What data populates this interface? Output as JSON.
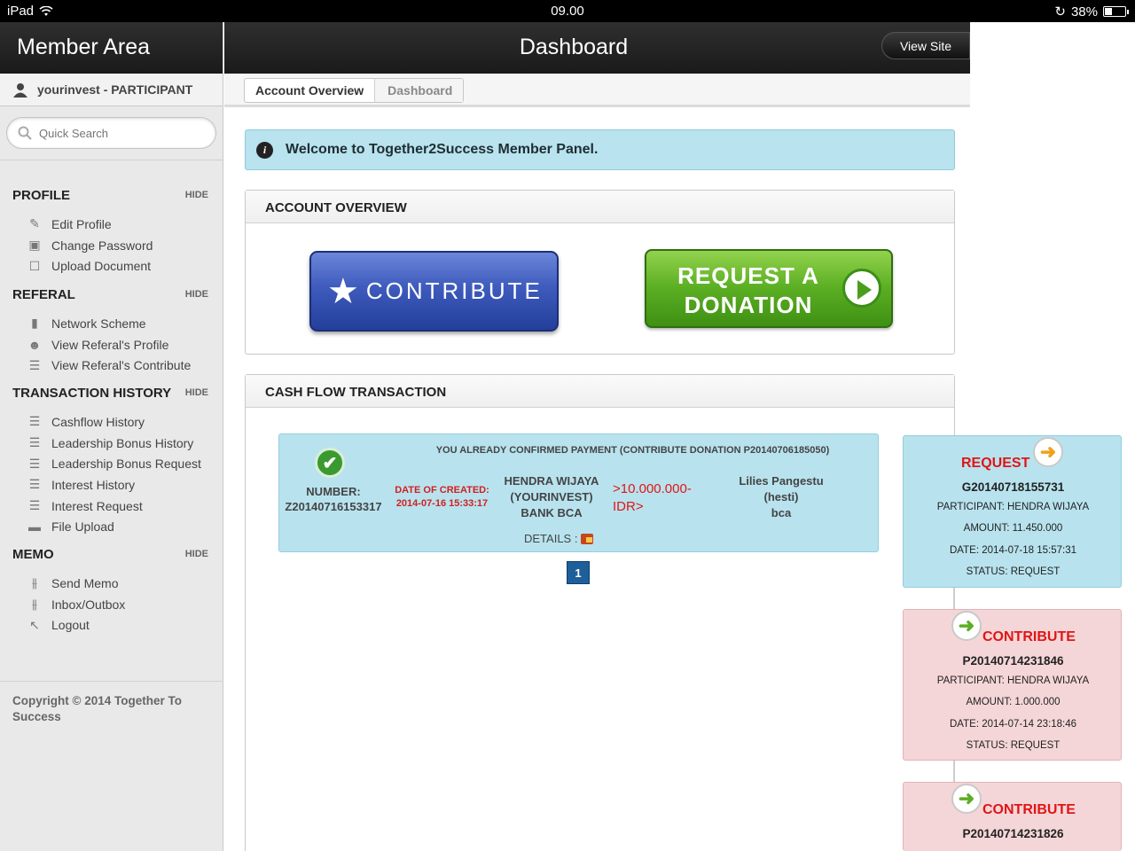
{
  "status_bar": {
    "device": "iPad",
    "time": "09.00",
    "battery_percent": "38%",
    "battery_level": 0.38
  },
  "sidebar": {
    "title": "Member Area",
    "user": "yourinvest - PARTICIPANT",
    "search_placeholder": "Quick Search",
    "sections": [
      {
        "title": "PROFILE",
        "hide": "HIDE",
        "items": [
          {
            "label": "Edit Profile",
            "icon": "pencil-icon"
          },
          {
            "label": "Change Password",
            "icon": "lock-icon"
          },
          {
            "label": "Upload Document",
            "icon": "upload-document-icon"
          }
        ]
      },
      {
        "title": "REFERAL",
        "hide": "HIDE",
        "items": [
          {
            "label": "Network Scheme",
            "icon": "bookmark-icon"
          },
          {
            "label": "View Referal's Profile",
            "icon": "users-icon"
          },
          {
            "label": "View Referal's Contribute",
            "icon": "list-icon"
          }
        ]
      },
      {
        "title": "TRANSACTION HISTORY",
        "hide": "HIDE",
        "items": [
          {
            "label": "Cashflow History",
            "icon": "list-icon"
          },
          {
            "label": "Leadership Bonus History",
            "icon": "list-icon"
          },
          {
            "label": "Leadership Bonus Request",
            "icon": "list-icon"
          },
          {
            "label": "Interest History",
            "icon": "list-icon"
          },
          {
            "label": "Interest Request",
            "icon": "list-icon"
          },
          {
            "label": "File Upload",
            "icon": "folder-icon"
          }
        ]
      },
      {
        "title": "MEMO",
        "hide": "HIDE",
        "items": [
          {
            "label": "Send Memo",
            "icon": "sliders-icon"
          },
          {
            "label": "Inbox/Outbox",
            "icon": "sliders-icon"
          },
          {
            "label": "Logout",
            "icon": "logout-arrow-icon"
          }
        ]
      }
    ],
    "copyright": "Copyright © 2014 Together To Success"
  },
  "header": {
    "title": "Dashboard",
    "view_site": "View Site"
  },
  "breadcrumb": {
    "items": [
      "Account Overview",
      "Dashboard"
    ]
  },
  "welcome": "Welcome to Together2Success Member Panel.",
  "account_overview": {
    "title": "ACCOUNT OVERVIEW",
    "contribute_label": "CONTRIBUTE",
    "donation_line1": "REQUEST A",
    "donation_line2": "DONATION"
  },
  "cash_flow": {
    "title": "CASH FLOW TRANSACTION",
    "transaction": {
      "heading": "YOU ALREADY CONFIRMED PAYMENT (CONTRIBUTE DONATION P20140706185050)",
      "number_label": "NUMBER:",
      "number": "Z20140716153317",
      "date_label": "DATE OF CREATED:",
      "date": "2014-07-16 15:33:17",
      "payer_name": "HENDRA WIJAYA",
      "payer_user": "(YOURINVEST)",
      "payer_bank": "BANK BCA",
      "amount_line1": ">10.000.000-",
      "amount_line2": "IDR>",
      "receiver_name": "Lilies Pangestu",
      "receiver_user": "(hesti)",
      "receiver_bank": "bca",
      "details_label": "DETAILS :"
    },
    "page": "1"
  },
  "right_cards": [
    {
      "type": "REQUEST",
      "id": "G20140718155731",
      "participant": "PARTICIPANT: HENDRA WIJAYA",
      "amount": "AMOUNT: 11.450.000",
      "date": "DATE: 2014-07-18 15:57:31",
      "status": "STATUS: REQUEST"
    },
    {
      "type": "CONTRIBUTE",
      "id": "P20140714231846",
      "participant": "PARTICIPANT: HENDRA WIJAYA",
      "amount": "AMOUNT: 1.000.000",
      "date": "DATE: 2014-07-14 23:18:46",
      "status": "STATUS: REQUEST"
    },
    {
      "type": "CONTRIBUTE",
      "id": "P20140714231826"
    }
  ]
}
